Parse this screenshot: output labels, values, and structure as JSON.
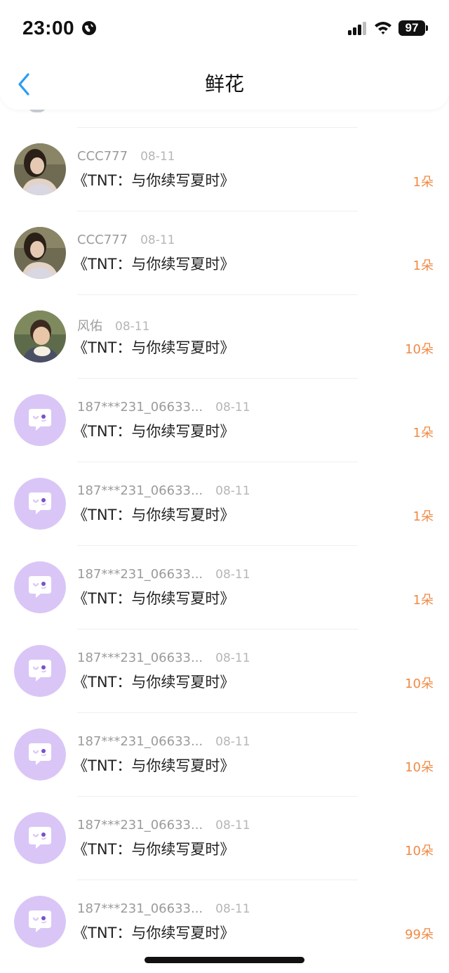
{
  "status_bar": {
    "time": "23:00",
    "battery": "97",
    "icons": [
      "globe-icon",
      "cellular-signal-icon",
      "wifi-icon",
      "battery-icon"
    ]
  },
  "header": {
    "back_icon": "chevron-left-icon",
    "title": "鲜花"
  },
  "colors": {
    "accent_blue": "#2b9cf2",
    "amount_orange": "#f08a45",
    "placeholder_avatar": "#d9c6f6"
  },
  "rows": [
    {
      "name": "CCC777",
      "date": "08-11",
      "title": "《TNT：与你续写夏时》",
      "amount": "1朵",
      "avatar": "photo-girl"
    },
    {
      "name": "CCC777",
      "date": "08-11",
      "title": "《TNT：与你续写夏时》",
      "amount": "1朵",
      "avatar": "photo-girl"
    },
    {
      "name": "风佑",
      "date": "08-11",
      "title": "《TNT：与你续写夏时》",
      "amount": "10朵",
      "avatar": "photo-child"
    },
    {
      "name": "187***231_06633...",
      "date": "08-11",
      "title": "《TNT：与你续写夏时》",
      "amount": "1朵",
      "avatar": "default-chat-bubble"
    },
    {
      "name": "187***231_06633...",
      "date": "08-11",
      "title": "《TNT：与你续写夏时》",
      "amount": "1朵",
      "avatar": "default-chat-bubble"
    },
    {
      "name": "187***231_06633...",
      "date": "08-11",
      "title": "《TNT：与你续写夏时》",
      "amount": "1朵",
      "avatar": "default-chat-bubble"
    },
    {
      "name": "187***231_06633...",
      "date": "08-11",
      "title": "《TNT：与你续写夏时》",
      "amount": "10朵",
      "avatar": "default-chat-bubble"
    },
    {
      "name": "187***231_06633...",
      "date": "08-11",
      "title": "《TNT：与你续写夏时》",
      "amount": "10朵",
      "avatar": "default-chat-bubble"
    },
    {
      "name": "187***231_06633...",
      "date": "08-11",
      "title": "《TNT：与你续写夏时》",
      "amount": "10朵",
      "avatar": "default-chat-bubble"
    },
    {
      "name": "187***231_06633...",
      "date": "08-11",
      "title": "《TNT：与你续写夏时》",
      "amount": "99朵",
      "avatar": "default-chat-bubble"
    }
  ]
}
